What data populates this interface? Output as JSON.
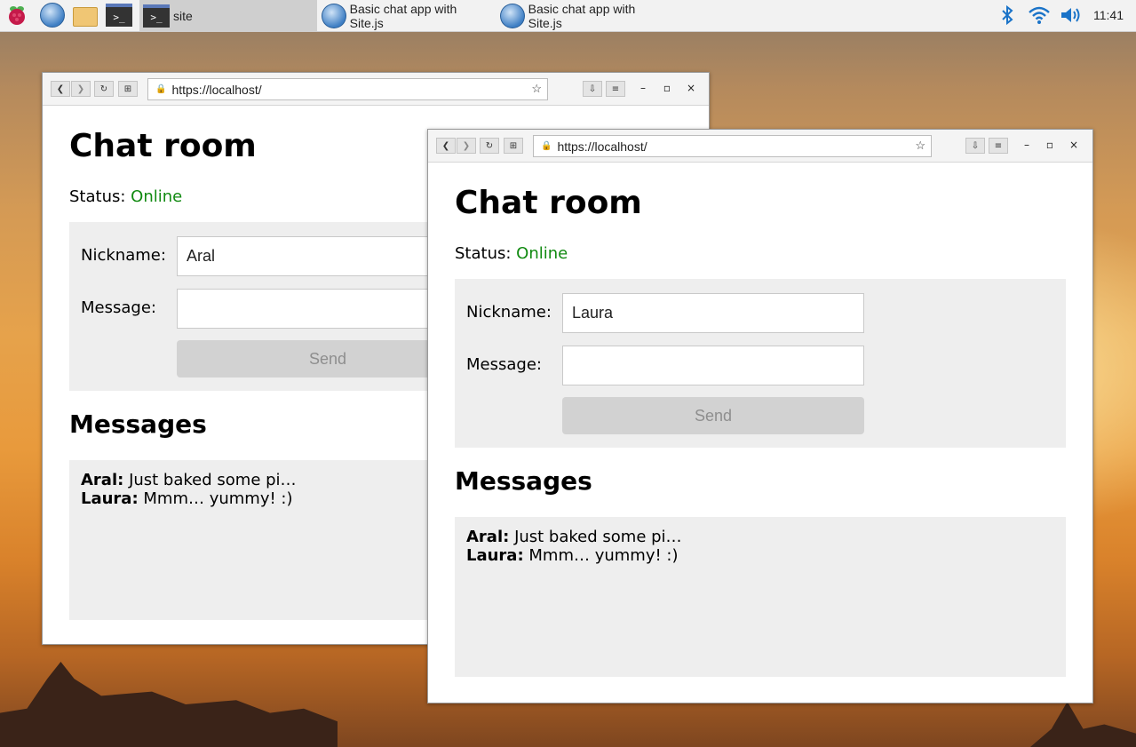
{
  "taskbar": {
    "tasks": [
      {
        "label": "site"
      },
      {
        "label": "Basic chat app with Site.js"
      },
      {
        "label": "Basic chat app with Site.js"
      }
    ],
    "clock": "11:41",
    "terminal_glyph": ">_"
  },
  "windows": [
    {
      "url": "https://localhost/",
      "title": "Chat room",
      "status_label": "Status:",
      "status_value": "Online",
      "nickname_label": "Nickname:",
      "nickname_value": "Aral",
      "message_label": "Message:",
      "message_value": "",
      "send_label": "Send",
      "messages_heading": "Messages",
      "messages": [
        {
          "author": "Aral:",
          "text": "Just baked some pi…"
        },
        {
          "author": "Laura:",
          "text": "Mmm… yummy! :)"
        }
      ]
    },
    {
      "url": "https://localhost/",
      "title": "Chat room",
      "status_label": "Status:",
      "status_value": "Online",
      "nickname_label": "Nickname:",
      "nickname_value": "Laura",
      "message_label": "Message:",
      "message_value": "",
      "send_label": "Send",
      "messages_heading": "Messages",
      "messages": [
        {
          "author": "Aral:",
          "text": "Just baked some pi…"
        },
        {
          "author": "Laura:",
          "text": "Mmm… yummy! :)"
        }
      ]
    }
  ],
  "colors": {
    "status_online": "#118a11",
    "form_background": "#eeeeee",
    "send_disabled": "#d2d2d2"
  }
}
